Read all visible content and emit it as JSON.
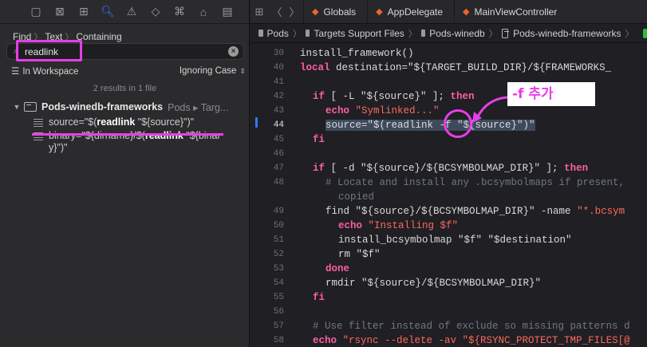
{
  "navigator": {
    "find_path": [
      "Find",
      "Text",
      "Containing"
    ],
    "search": {
      "value": "readlink"
    },
    "scope": "In Workspace",
    "match_mode": "Ignoring Case",
    "result_count": "2 results in 1 file",
    "project": {
      "name": "Pods-winedb-frameworks",
      "path": "Pods ▸ Targ..."
    },
    "matches": [
      {
        "before": "source=\"$(",
        "match": "readlink",
        "after": " \"${source}\")\""
      },
      {
        "before": "binary=\"${dirname}/$(",
        "match": "readlink",
        "after": " \"${binary}\")\""
      }
    ]
  },
  "editor": {
    "tabs": [
      "Globals",
      "AppDelegate",
      "MainViewController"
    ],
    "breadcrumbs": [
      "Pods",
      "Targets Support Files",
      "Pods-winedb",
      "Pods-winedb-frameworks"
    ],
    "line_numbers": [
      "30",
      "40",
      "41",
      "42",
      "43",
      "44",
      "45",
      "46",
      "47",
      "48",
      "",
      "49",
      "50",
      "51",
      "52",
      "53",
      "54",
      "55",
      "56",
      "57",
      "58"
    ],
    "annotation": "-f 추가",
    "lines": {
      "l30": "install_framework()",
      "l40a": "  local destination=\"${TARGET_BUILD_DIR}/${FRAMEWORKS_",
      "l42_kw": "if",
      "l42_rest": " [ -L \"${source}\" ]; ",
      "l42_then": "then",
      "l43_cmd": "echo ",
      "l43_str": "\"Symlinked...\"",
      "l44": "source=\"$(readlink -f \"${source}\")\"",
      "l45": "fi",
      "l47_kw": "if",
      "l47_rest": " [ -d \"${source}/${BCSYMBOLMAP_DIR}\" ]; ",
      "l47_then": "then",
      "l48": "# Locate and install any .bcsymbolmaps if present,",
      "l48b": "copied",
      "l49_a": "find \"${source}/${BCSYMBOLMAP_DIR}\" -name ",
      "l49_b": "\"*.bcsym",
      "l50_cmd": "echo ",
      "l50_str": "\"Installing $f\"",
      "l51": "install_bcsymbolmap \"$f\" \"$destination\"",
      "l52": "rm \"$f\"",
      "l53": "done",
      "l54": "rmdir \"${source}/${BCSYMBOLMAP_DIR}\"",
      "l55": "fi",
      "l57": "# Use filter instead of exclude so missing patterns d",
      "l58_cmd": "echo ",
      "l58_str": "\"rsync --delete -av \"${RSYNC_PROTECT_TMP_FILES[@"
    }
  },
  "colors": {
    "accent": "#2f7cf6",
    "annotation": "#e83ee8"
  }
}
